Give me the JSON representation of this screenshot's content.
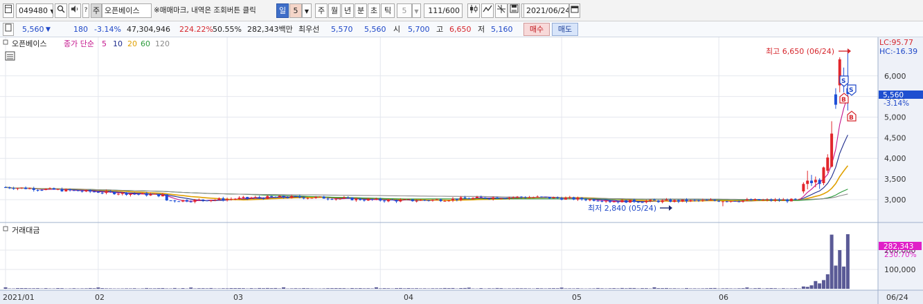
{
  "toolbar": {
    "stock_code": "049480",
    "code_caret": "▼",
    "search_glyph": "🔍",
    "sound_glyph": "🔊",
    "hint_glyph": "?",
    "market_tag": "주",
    "stock_name": "오픈베이스",
    "mark_hint": "※매매마크, 내역은 조회버튼 클릭",
    "periods": [
      {
        "label": "일",
        "selected": true
      },
      {
        "label": "5",
        "selected": false,
        "dropdown": true
      },
      {
        "label": "주",
        "selected": false
      },
      {
        "label": "월",
        "selected": false
      },
      {
        "label": "년",
        "selected": false
      },
      {
        "label": "분",
        "selected": false
      },
      {
        "label": "초",
        "selected": false
      },
      {
        "label": "틱",
        "selected": false
      },
      {
        "label": "5",
        "selected": false,
        "disabled": true
      }
    ],
    "count_display": "111/600",
    "date": "2021/06/24"
  },
  "quote": {
    "price": "5,560",
    "change_arrow": "▼",
    "change": "180",
    "change_pct": "-3.14%",
    "volume": "47,304,946",
    "volume_ratio": "224.22%",
    "turnover": "50.55%",
    "amount": "282,343백만",
    "best_label": "최우선",
    "best_ask": "5,570",
    "best_bid": "5,560",
    "open_label": "시",
    "open": "5,700",
    "high_label": "고",
    "high": "6,650",
    "low_label": "저",
    "low": "5,160",
    "buy_button": "매수",
    "sell_button": "매도"
  },
  "price_panel": {
    "title": "오픈베이스",
    "ma_label": "종가 단순",
    "ma_periods": [
      "5",
      "10",
      "20",
      "60",
      "120"
    ],
    "lc_label": "LC:95.77",
    "hc_label": "HC:-16.39",
    "current_price_tag": "5,560",
    "current_change_tag": "-3.14%",
    "max_annotation": "최고 6,650 (06/24)",
    "min_annotation": "최저 2,840 (05/24)",
    "trade_marks": [
      "S",
      "S",
      "B",
      "B"
    ]
  },
  "volume_panel": {
    "title": "거래대금",
    "value_tag": "282,343",
    "pct_tag": "230.70%"
  },
  "x_axis": {
    "labels": [
      "2021/01",
      "02",
      "03",
      "04",
      "05",
      "06",
      "06/24"
    ]
  },
  "colors": {
    "up": "#e2262b",
    "down": "#1e4fd8",
    "ma5": "#c4148c",
    "ma10": "#1c2a8c",
    "ma20": "#e0a000",
    "ma60": "#2a9a3a",
    "ma120": "#8a8a8a",
    "volume_bar": "#5a5a96",
    "price_tag_bg": "#1f4fd0",
    "volume_tag_bg": "#e020c8"
  },
  "chart_data": {
    "type": "candlestick",
    "period": "daily",
    "y_ticks": [
      3000,
      3500,
      4000,
      4500,
      5000,
      5500,
      6000
    ],
    "ylim": [
      2480,
      6900
    ],
    "volume_ticks": [
      100000,
      200000
    ],
    "volume_ylim": [
      0,
      300000
    ],
    "month_starts": {
      "2021/01": 0,
      "02": 23,
      "03": 55,
      "04": 93,
      "05": 138,
      "06": 177
    },
    "last_close": 5560,
    "high": {
      "value": 6650,
      "date": "06/24"
    },
    "low": {
      "value": 2840,
      "date": "05/24"
    },
    "recent_candles": [
      {
        "open": 3200,
        "high": 3420,
        "low": 3150,
        "close": 3380
      },
      {
        "open": 3380,
        "high": 3700,
        "low": 3250,
        "close": 3460
      },
      {
        "open": 3460,
        "high": 3600,
        "low": 3330,
        "close": 3400
      },
      {
        "open": 3420,
        "high": 3560,
        "low": 3300,
        "close": 3480
      },
      {
        "open": 3480,
        "high": 3520,
        "low": 3260,
        "close": 3380
      },
      {
        "open": 3400,
        "high": 3800,
        "low": 3350,
        "close": 3780
      },
      {
        "open": 3700,
        "high": 4100,
        "low": 3650,
        "close": 4020
      },
      {
        "open": 3800,
        "high": 4900,
        "low": 3780,
        "close": 4600
      },
      {
        "open": 5550,
        "high": 5700,
        "low": 5200,
        "close": 5300
      },
      {
        "open": 5770,
        "high": 6450,
        "low": 5600,
        "close": 6400
      },
      {
        "open": 5800,
        "high": 6200,
        "low": 5600,
        "close": 5750
      },
      {
        "open": 5700,
        "high": 6650,
        "low": 5160,
        "close": 5560
      }
    ],
    "recent_volume": [
      15000,
      12000,
      10000,
      18000,
      40000,
      28000,
      45000,
      75000,
      280000,
      120000,
      200000,
      115000,
      282343
    ]
  }
}
